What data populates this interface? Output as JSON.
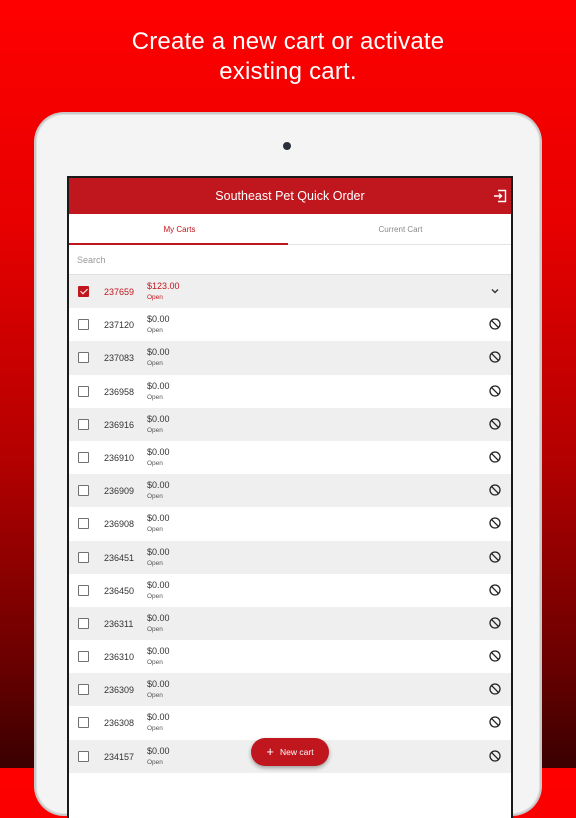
{
  "headline": {
    "line1": "Create a new cart or activate",
    "line2": "existing cart."
  },
  "app": {
    "title": "Southeast Pet Quick Order",
    "logout_icon": "logout-icon"
  },
  "tabs": [
    {
      "label": "My Carts",
      "active": true
    },
    {
      "label": "Current Cart",
      "active": false
    }
  ],
  "search": {
    "placeholder": "Search",
    "value": ""
  },
  "carts": [
    {
      "id": "237659",
      "amount": "$123.00",
      "status": "Open",
      "checked": true,
      "icon": "chevron-down-icon"
    },
    {
      "id": "237120",
      "amount": "$0.00",
      "status": "Open",
      "checked": false,
      "icon": "block-icon"
    },
    {
      "id": "237083",
      "amount": "$0.00",
      "status": "Open",
      "checked": false,
      "icon": "block-icon"
    },
    {
      "id": "236958",
      "amount": "$0.00",
      "status": "Open",
      "checked": false,
      "icon": "block-icon"
    },
    {
      "id": "236916",
      "amount": "$0.00",
      "status": "Open",
      "checked": false,
      "icon": "block-icon"
    },
    {
      "id": "236910",
      "amount": "$0.00",
      "status": "Open",
      "checked": false,
      "icon": "block-icon"
    },
    {
      "id": "236909",
      "amount": "$0.00",
      "status": "Open",
      "checked": false,
      "icon": "block-icon"
    },
    {
      "id": "236908",
      "amount": "$0.00",
      "status": "Open",
      "checked": false,
      "icon": "block-icon"
    },
    {
      "id": "236451",
      "amount": "$0.00",
      "status": "Open",
      "checked": false,
      "icon": "block-icon"
    },
    {
      "id": "236450",
      "amount": "$0.00",
      "status": "Open",
      "checked": false,
      "icon": "block-icon"
    },
    {
      "id": "236311",
      "amount": "$0.00",
      "status": "Open",
      "checked": false,
      "icon": "block-icon"
    },
    {
      "id": "236310",
      "amount": "$0.00",
      "status": "Open",
      "checked": false,
      "icon": "block-icon"
    },
    {
      "id": "236309",
      "amount": "$0.00",
      "status": "Open",
      "checked": false,
      "icon": "block-icon"
    },
    {
      "id": "236308",
      "amount": "$0.00",
      "status": "Open",
      "checked": false,
      "icon": "block-icon"
    },
    {
      "id": "234157",
      "amount": "$0.00",
      "status": "Open",
      "checked": false,
      "icon": "block-icon"
    }
  ],
  "fab": {
    "label": "New cart",
    "icon": "plus-icon"
  },
  "colors": {
    "brand": "#c0161e",
    "alt_row": "#efefef"
  }
}
